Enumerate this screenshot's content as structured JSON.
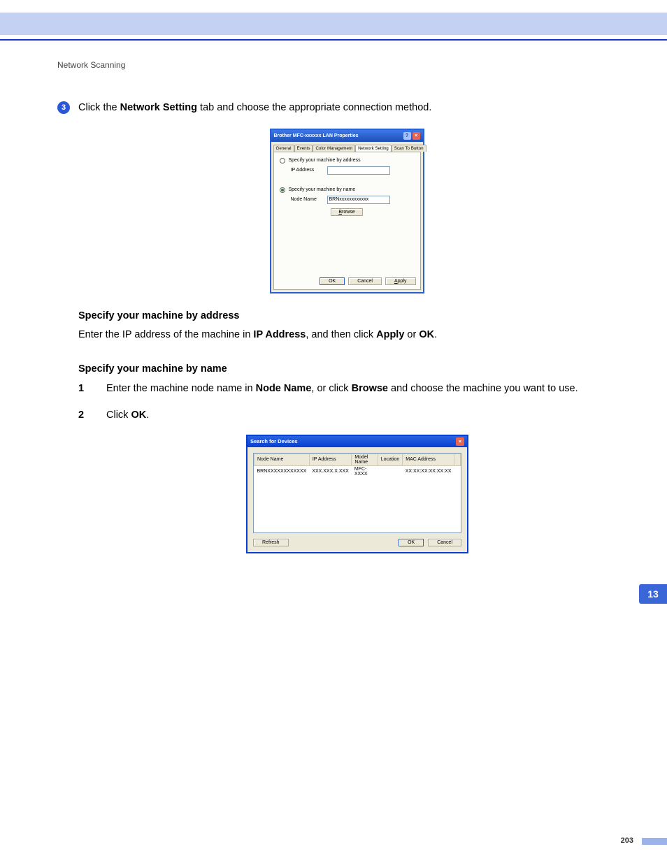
{
  "breadcrumb": "Network Scanning",
  "step3": {
    "num": "3",
    "prefix": "Click the ",
    "bold1": "Network Setting",
    "suffix": " tab and choose the appropriate connection method."
  },
  "section_addr": {
    "heading": "Specify your machine by address",
    "body_prefix": "Enter the IP address of the machine in ",
    "body_bold1": "IP Address",
    "body_mid": ", and then click ",
    "body_bold2": "Apply",
    "body_or": " or ",
    "body_bold3": "OK",
    "body_end": "."
  },
  "section_name": {
    "heading": "Specify your machine by name",
    "steps": [
      {
        "n": "1",
        "p1": "Enter the machine node name in ",
        "b1": "Node Name",
        "p2": ", or click ",
        "b2": "Browse",
        "p3": " and choose the machine you want to use."
      },
      {
        "n": "2",
        "p1": "Click ",
        "b1": "OK",
        "p2": "."
      }
    ]
  },
  "dlg1": {
    "title": "Brother MFC-xxxxxx  LAN Properties",
    "tabs": [
      "General",
      "Events",
      "Color Management",
      "Network Setting",
      "Scan To Button"
    ],
    "active_tab_idx": 3,
    "radio_addr": "Specify your machine by address",
    "label_ip": "IP Address",
    "radio_name": "Specify your machine by name",
    "label_node": "Node Name",
    "node_value": "BRNxxxxxxxxxxxx",
    "btn_browse": "Browse",
    "btn_ok": "OK",
    "btn_cancel": "Cancel",
    "btn_apply": "Apply"
  },
  "dlg2": {
    "title": "Search for Devices",
    "cols": [
      "Node Name",
      "IP Address",
      "Model Name",
      "Location",
      "MAC Address"
    ],
    "row": [
      "BRNXXXXXXXXXXXX",
      "XXX.XXX.X.XXX",
      "MFC-XXXX",
      "",
      "XX:XX:XX:XX:XX:XX"
    ],
    "btn_refresh": "Refresh",
    "btn_ok": "OK",
    "btn_cancel": "Cancel"
  },
  "side_tab": "13",
  "page_num": "203"
}
